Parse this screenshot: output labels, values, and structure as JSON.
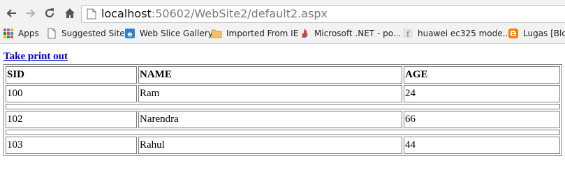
{
  "browser": {
    "url_host": "localhost",
    "url_path": ":50602/WebSite2/default2.aspx",
    "icons": [
      "back-arrow-icon",
      "forward-arrow-icon",
      "reload-icon",
      "home-icon",
      "page-icon"
    ]
  },
  "bookmarks": [
    {
      "label": "Apps",
      "icon": "apps-grid-icon"
    },
    {
      "label": "Suggested Sites",
      "icon": "page-icon"
    },
    {
      "label": "Web Slice Gallery",
      "icon": "ie-icon"
    },
    {
      "label": "Imported From IE",
      "icon": "folder-icon"
    },
    {
      "label": "Microsoft .NET - po...",
      "icon": "dotnet-icon"
    },
    {
      "label": "huawei ec325 mode...",
      "icon": "f-icon"
    },
    {
      "label": "Lugas [Blog",
      "icon": "blogger-icon"
    }
  ],
  "page": {
    "print_link": "Take print out",
    "table": {
      "headers": [
        "SID",
        "NAME",
        "AGE"
      ],
      "rows": [
        [
          "100",
          "Ram",
          "24"
        ],
        [
          "102",
          "Narendra",
          "66"
        ],
        [
          "103",
          "Rahul",
          "44"
        ]
      ]
    }
  },
  "colors": {
    "link": "#0000cc",
    "border": "#7f7f7f",
    "chrome_bg": "#f2f2f2"
  }
}
